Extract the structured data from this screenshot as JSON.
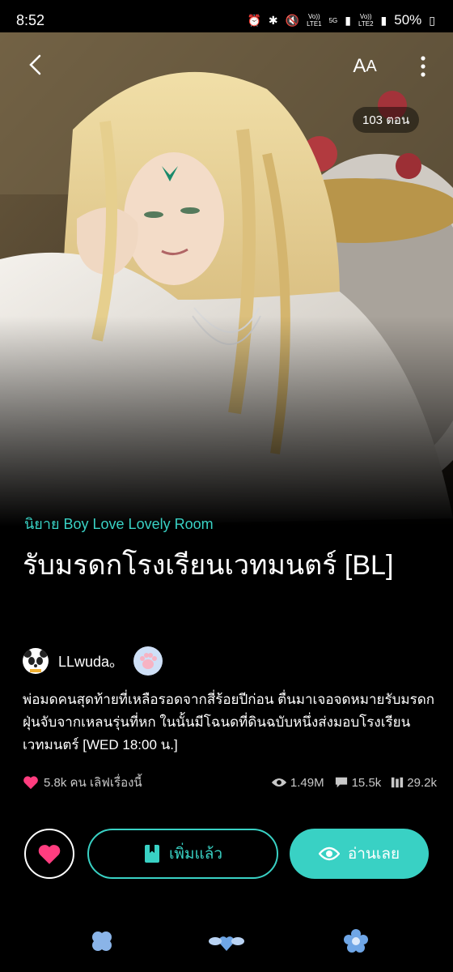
{
  "status_bar": {
    "time": "8:52",
    "net1_top": "Vo))",
    "net1_bottom": "LTE1",
    "net_5g": "5G",
    "net2_top": "Vo))",
    "net2_bottom": "LTE2",
    "battery": "50%"
  },
  "toolbar": {
    "font_size_label": "A",
    "font_size_label_small": "A"
  },
  "cover": {
    "episode_count": "103 ตอน"
  },
  "story": {
    "category": "นิยาย Boy Love Lovely Room",
    "title": "รับมรดกโรงเรียนเวทมนตร์ [BL]",
    "author": "LLwuda。",
    "synopsis": "พ่อมดคนสุดท้ายที่เหลือรอดจากสี่ร้อยปีก่อน ตื่นมาเจอจดหมายรับมรดกฝุ่นจับจากเหลนรุ่นที่หก ในนั้นมีโฉนดที่ดินฉบับหนึ่งส่งมอบโรงเรียนเวทมนตร์ [WED 18:00 น.]"
  },
  "stats": {
    "likes_text": "5.8k คน เลิฟเรื่องนี้",
    "views": "1.49M",
    "comments": "15.5k",
    "bookmarks": "29.2k"
  },
  "actions": {
    "added_label": "เพิ่มแล้ว",
    "read_label": "อ่านเลย"
  },
  "colors": {
    "accent": "#39d1c4",
    "heart": "#ff3d7f",
    "background": "#000000"
  }
}
